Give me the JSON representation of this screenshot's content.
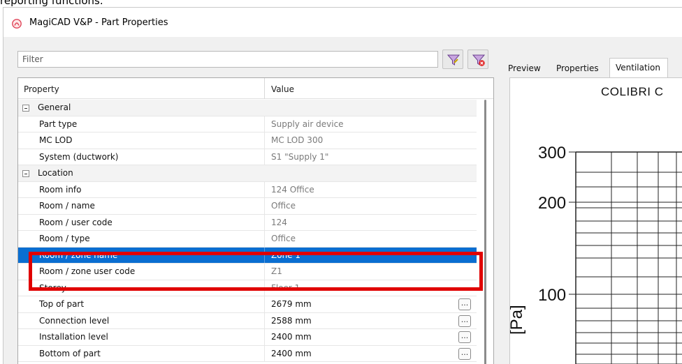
{
  "caption": "reporting functions.",
  "window": {
    "title": "MagiCAD V&P - Part Properties",
    "accent_color": "#0a6ed1",
    "highlight_color": "#e00000"
  },
  "filter": {
    "placeholder": "Filter",
    "funnel_icon": "funnel-icon",
    "clear_filter_icon": "clear-filter-icon"
  },
  "grid": {
    "columns": [
      "Property",
      "Value"
    ],
    "rows": [
      {
        "type": "category",
        "name": "General"
      },
      {
        "type": "item",
        "name": "Part type",
        "value": "Supply air device"
      },
      {
        "type": "item",
        "name": "MC LOD",
        "value": "MC LOD 300"
      },
      {
        "type": "item",
        "name": "System (ductwork)",
        "value": "S1 \"Supply 1\""
      },
      {
        "type": "category",
        "name": "Location"
      },
      {
        "type": "item",
        "name": "Room info",
        "value": "124 Office"
      },
      {
        "type": "item",
        "name": "Room / name",
        "value": "Office"
      },
      {
        "type": "item",
        "name": "Room / user code",
        "value": "124"
      },
      {
        "type": "item",
        "name": "Room / type",
        "value": "Office"
      },
      {
        "type": "item",
        "name": "Room / zone name",
        "value": "Zone 1",
        "selected": true
      },
      {
        "type": "item",
        "name": "Room / zone user code",
        "value": "Z1"
      },
      {
        "type": "item",
        "name": "Storey",
        "value": "Floor 1"
      },
      {
        "type": "item",
        "name": "Top of part",
        "value": "2679 mm",
        "editable": true
      },
      {
        "type": "item",
        "name": "Connection level",
        "value": "2588 mm",
        "editable": true
      },
      {
        "type": "item",
        "name": "Installation level",
        "value": "2400 mm",
        "editable": true
      },
      {
        "type": "item",
        "name": "Bottom of part",
        "value": "2400 mm",
        "editable": true
      }
    ],
    "ellipsis_label": "..."
  },
  "tabs": [
    {
      "label": "Preview",
      "active": false
    },
    {
      "label": "Properties",
      "active": false
    },
    {
      "label": "Ventilation",
      "active": true
    }
  ],
  "preview": {
    "title": "COLIBRI C",
    "yticks": [
      "300",
      "200",
      "100"
    ],
    "ylabel": "[Pa]"
  }
}
